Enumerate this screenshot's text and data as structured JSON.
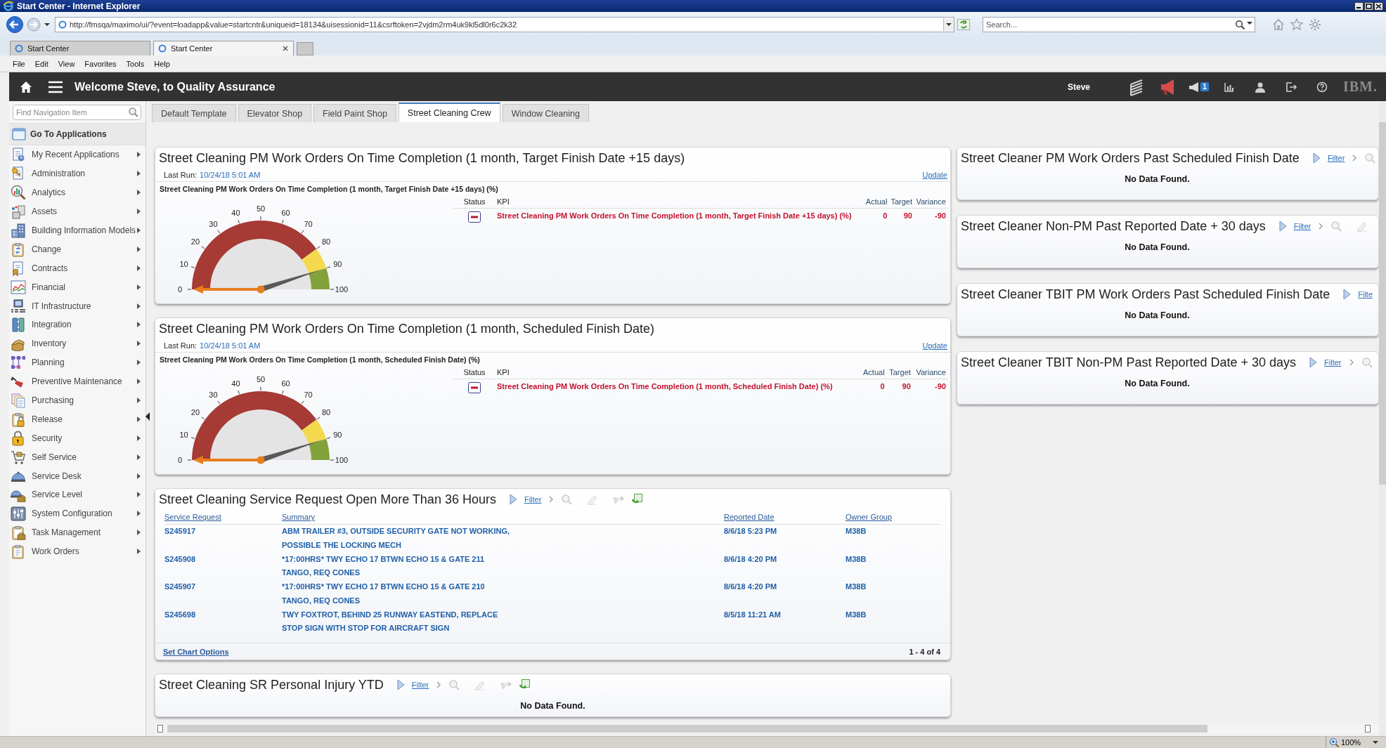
{
  "browser": {
    "title": "Start Center - Internet Explorer",
    "address": "http://fmsqa/maximo/ui/?event=loadapp&value=startcntr&uniqueid=18134&uisessionid=11&csrftoken=2vjdm2rm4uk9kl5dl0r6c2k32",
    "search": {
      "placeholder": "Search..."
    },
    "tabs": [
      {
        "label": "Start Center",
        "selected": false
      },
      {
        "label": "Start Center",
        "selected": true
      }
    ],
    "menu": [
      "File",
      "Edit",
      "View",
      "Favorites",
      "Tools",
      "Help"
    ]
  },
  "app_header": {
    "title": "Welcome Steve, to Quality Assurance",
    "user": "Steve",
    "badge": "1",
    "logo": "IBM."
  },
  "sidebar": {
    "search": {
      "placeholder": "Find Navigation Item"
    },
    "go_to": "Go To Applications",
    "items": [
      "My Recent Applications",
      "Administration",
      "Analytics",
      "Assets",
      "Building Information Models",
      "Change",
      "Contracts",
      "Financial",
      "IT Infrastructure",
      "Integration",
      "Inventory",
      "Planning",
      "Preventive Maintenance",
      "Purchasing",
      "Release",
      "Security",
      "Self Service",
      "Service Desk",
      "Service Level",
      "System Configuration",
      "Task Management",
      "Work Orders"
    ]
  },
  "tabs": [
    {
      "label": "Default Template",
      "selected": false
    },
    {
      "label": "Elevator Shop",
      "selected": false
    },
    {
      "label": "Field Paint Shop",
      "selected": false
    },
    {
      "label": "Street Cleaning Crew",
      "selected": true
    },
    {
      "label": "Window Cleaning",
      "selected": false
    }
  ],
  "left_column": [
    {
      "kind": "kpi",
      "title": "Street Cleaning PM Work Orders On Time Completion (1 month, Target Finish Date +15 days)",
      "last_run_label": "Last Run:",
      "last_run": "10/24/18 5:01 AM",
      "update": "Update",
      "chart_title": "Street Cleaning PM Work Orders On Time Completion (1 month, Target Finish Date +15 days) (%)",
      "gauge": {
        "ticks": [
          "0",
          "10",
          "20",
          "30",
          "40",
          "50",
          "60",
          "70",
          "80",
          "90",
          "100"
        ]
      },
      "columns": [
        "Status",
        "KPI",
        "Actual",
        "Target",
        "Variance"
      ],
      "rows": [
        {
          "kind": "below_target",
          "kpi": "Street Cleaning PM Work Orders On Time Completion (1 month, Target Finish Date +15 days) (%)",
          "actual": "0",
          "target": "90",
          "variance": "-90"
        }
      ]
    },
    {
      "kind": "kpi",
      "title": "Street Cleaning PM Work Orders On Time Completion (1 month, Scheduled Finish Date)",
      "last_run_label": "Last Run:",
      "last_run": "10/24/18 5:01 AM",
      "update": "Update",
      "chart_title": "Street Cleaning PM Work Orders On Time Completion (1 month, Scheduled Finish Date) (%)",
      "gauge": {
        "ticks": [
          "0",
          "10",
          "20",
          "30",
          "40",
          "50",
          "60",
          "70",
          "80",
          "90",
          "100"
        ]
      },
      "columns": [
        "Status",
        "KPI",
        "Actual",
        "Target",
        "Variance"
      ],
      "rows": [
        {
          "kind": "below_target",
          "kpi": "Street Cleaning PM Work Orders On Time Completion (1 month, Scheduled Finish Date) (%)",
          "actual": "0",
          "target": "90",
          "variance": "-90"
        }
      ]
    },
    {
      "kind": "list",
      "title": "Street Cleaning Service Request Open More Than 36 Hours",
      "tools": [
        {
          "kind": "expand"
        },
        {
          "kind": "link",
          "label": "Filter"
        },
        {
          "kind": "chevron"
        },
        {
          "kind": "search"
        },
        {
          "kind": "eraser"
        },
        {
          "kind": "download"
        },
        {
          "kind": "refresh"
        }
      ],
      "columns": [
        "Service Request",
        "Summary",
        "Reported Date",
        "Owner Group"
      ],
      "rows": [
        {
          "service_request": "S245917",
          "summary": [
            "ABM TRAILER #3, OUTSIDE SECURITY GATE NOT WORKING,",
            "POSSIBLE THE LOCKING MECH"
          ],
          "reported_date": "8/6/18 5:23 PM",
          "owner_group": "M38B"
        },
        {
          "service_request": "S245908",
          "summary": [
            "*17:00HRS* TWY ECHO 17 BTWN ECHO 15 & GATE 211",
            "TANGO, REQ CONES"
          ],
          "reported_date": "8/6/18 4:20 PM",
          "owner_group": "M38B"
        },
        {
          "service_request": "S245907",
          "summary": [
            "*17:00HRS* TWY ECHO 17 BTWN ECHO 15 & GATE 210",
            "TANGO, REQ CONES"
          ],
          "reported_date": "8/6/18 4:20 PM",
          "owner_group": "M38B"
        },
        {
          "service_request": "S245698",
          "summary": [
            "TWY FOXTROT, BEHIND 25 RUNWAY EASTEND, REPLACE",
            "STOP SIGN WITH STOP FOR AIRCRAFT SIGN"
          ],
          "reported_date": "8/5/18 11:21 AM",
          "owner_group": "M38B"
        }
      ],
      "footer_link": "Set Chart Options",
      "count": "1 - 4 of 4"
    },
    {
      "kind": "empty",
      "title": "Street Cleaning SR Personal Injury YTD",
      "tools": [
        {
          "kind": "expand"
        },
        {
          "kind": "link",
          "label": "Filter"
        },
        {
          "kind": "chevron"
        },
        {
          "kind": "search"
        },
        {
          "kind": "eraser"
        },
        {
          "kind": "download"
        },
        {
          "kind": "refresh"
        }
      ],
      "message": "No Data Found."
    }
  ],
  "right_column": [
    {
      "kind": "empty",
      "title": "Street Cleaner PM Work Orders Past Scheduled Finish Date",
      "tools": [
        {
          "kind": "expand"
        },
        {
          "kind": "link",
          "label": "Filter"
        },
        {
          "kind": "chevron"
        },
        {
          "kind": "search"
        }
      ],
      "message": "No Data Found."
    },
    {
      "kind": "empty",
      "title": "Street Cleaner Non-PM Past Reported Date + 30 days",
      "tools": [
        {
          "kind": "expand"
        },
        {
          "kind": "link",
          "label": "Filter"
        },
        {
          "kind": "chevron"
        },
        {
          "kind": "search"
        },
        {
          "kind": "eraser"
        }
      ],
      "message": "No Data Found."
    },
    {
      "kind": "empty",
      "title": "Street Cleaner TBIT PM Work Orders Past Scheduled Finish Date",
      "tools": [
        {
          "kind": "expand"
        },
        {
          "kind": "link",
          "label": "Filte"
        }
      ],
      "message": "No Data Found."
    },
    {
      "kind": "empty",
      "title": "Street Cleaner TBIT Non-PM Past Reported Date + 30 days",
      "tools": [
        {
          "kind": "expand"
        },
        {
          "kind": "link",
          "label": "Filter"
        },
        {
          "kind": "chevron"
        },
        {
          "kind": "search"
        }
      ],
      "message": "No Data Found."
    }
  ],
  "status_bar": {
    "zoom": "100%"
  }
}
